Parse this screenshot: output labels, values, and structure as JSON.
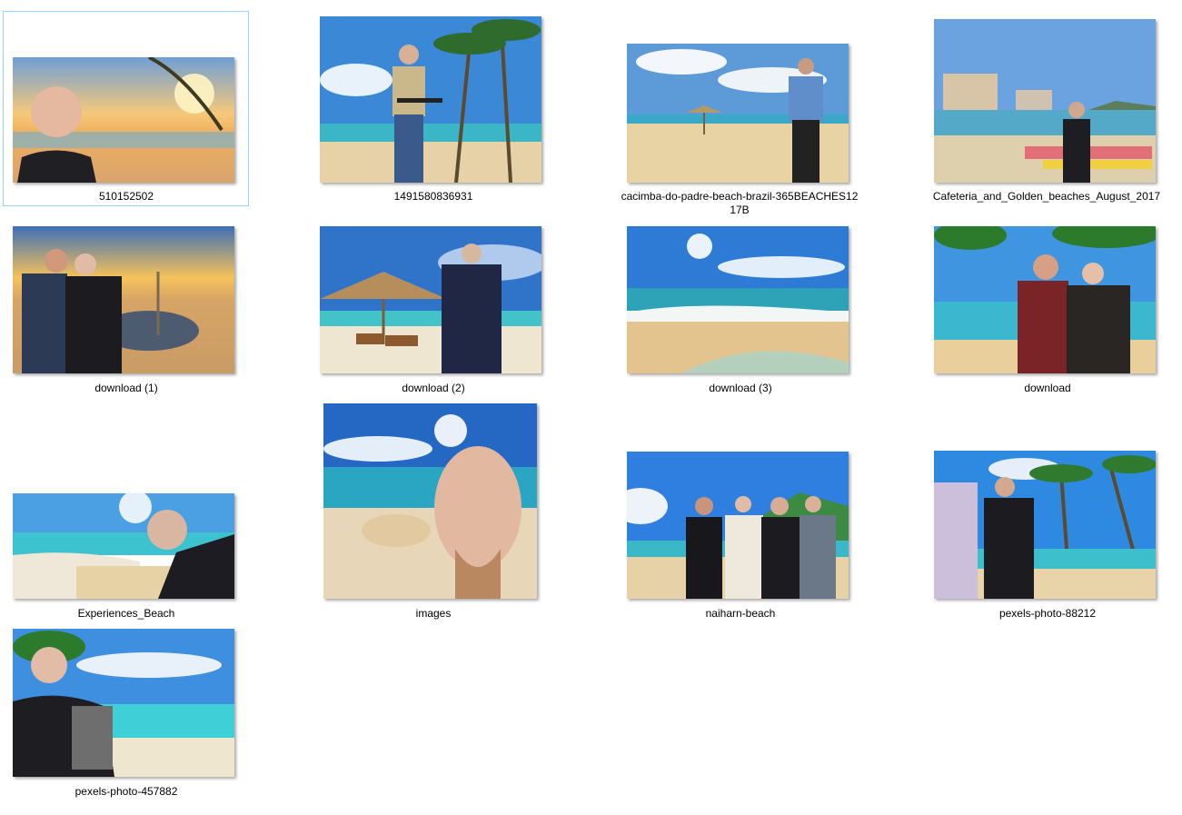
{
  "files": [
    {
      "name": "510152502",
      "scene": "sunset-beach-selfie"
    },
    {
      "name": "1491580836931",
      "scene": "palm-beach-man-rifle"
    },
    {
      "name": "cacimba-do-padre-beach-brazil-365BEACHES12\n17B",
      "scene": "beach-umbrella-guard"
    },
    {
      "name": "Cafeteria_and_Golden_beaches_August_2017",
      "scene": "city-beach-crowd"
    },
    {
      "name": "download (1)",
      "scene": "sunset-pool-two-men"
    },
    {
      "name": "download (2)",
      "scene": "hut-beach-man"
    },
    {
      "name": "download (3)",
      "scene": "waves-empty-beach"
    },
    {
      "name": "download",
      "scene": "tropical-two-men-thumbs"
    },
    {
      "name": "Experiences_Beach",
      "scene": "beach-selfie-glasses"
    },
    {
      "name": "images",
      "scene": "shell-beach-closeup"
    },
    {
      "name": "naiharn-beach",
      "scene": "four-men-lagoon"
    },
    {
      "name": "pexels-photo-88212",
      "scene": "cosplay-palm-beach"
    },
    {
      "name": "pexels-photo-457882",
      "scene": "lagoon-selfie"
    }
  ],
  "colors": {
    "selection_border": "#99d1ff",
    "sky": "#3f8fd8",
    "sand": "#e7cf9a",
    "sea": "#3ab5c9"
  }
}
